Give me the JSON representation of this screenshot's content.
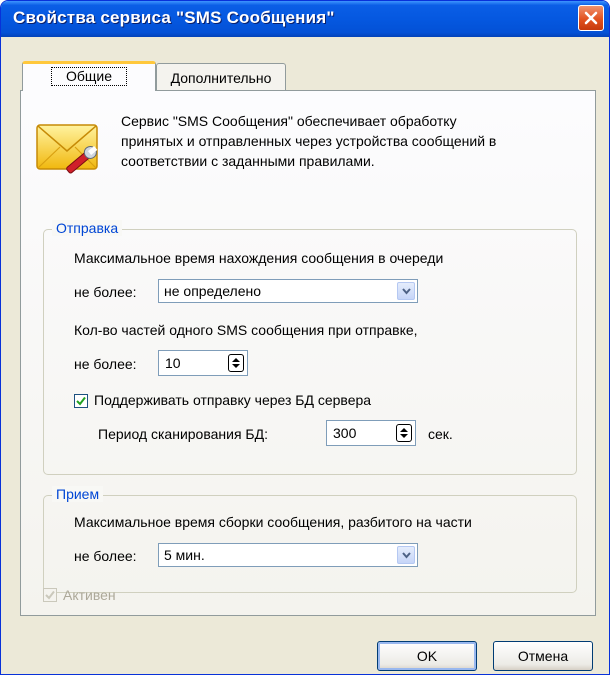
{
  "window": {
    "title": "Свойства сервиса \"SMS Сообщения\""
  },
  "tabs": [
    {
      "label": "Общие",
      "active": true
    },
    {
      "label": "Дополнительно",
      "active": false
    }
  ],
  "description": {
    "line1": "Сервис \"SMS Сообщения\" обеспечивает обработку",
    "line2": "принятых и отправленных через устройства сообщений в",
    "line3": "соответствии с заданными правилами."
  },
  "send": {
    "legend": "Отправка",
    "queue_label": "Максимальное время нахождения сообщения в очереди",
    "queue_prefix": "не более:",
    "queue_value": "не определено",
    "parts_label": "Кол-во частей одного SMS сообщения при отправке,",
    "parts_prefix": "не более:",
    "parts_value": "10",
    "db_checkbox_label": "Поддерживать отправку через БД сервера",
    "db_checked": true,
    "scan_label": "Период сканирования БД:",
    "scan_value": "300",
    "scan_unit": "сек."
  },
  "receive": {
    "legend": "Прием",
    "assembly_label": "Максимальное время сборки сообщения, разбитого на части",
    "assembly_prefix": "не более:",
    "assembly_value": "5 мин."
  },
  "active": {
    "label": "Активен",
    "checked": true,
    "disabled": true
  },
  "buttons": {
    "ok": "OK",
    "cancel": "Отмена"
  },
  "colors": {
    "titlebar": "#0558e0",
    "legend": "#0046d5",
    "tab_highlight": "#ffc83c",
    "close": "#e2521f"
  }
}
